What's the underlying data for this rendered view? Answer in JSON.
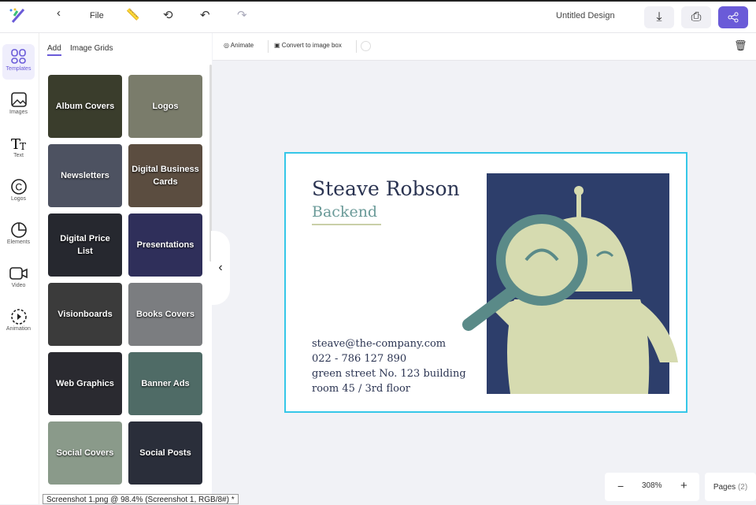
{
  "header": {
    "file": "File",
    "title": "Untitled Design"
  },
  "rail": [
    {
      "label": "Templates"
    },
    {
      "label": "Images"
    },
    {
      "label": "Text"
    },
    {
      "label": "Logos"
    },
    {
      "label": "Elements"
    },
    {
      "label": "Video"
    },
    {
      "label": "Animation"
    }
  ],
  "panel": {
    "tabs": [
      "Add",
      "Image Grids"
    ],
    "items": [
      {
        "label": "Album Covers",
        "color": "#3a3d2c"
      },
      {
        "label": "Logos",
        "color": "#7a7c6b"
      },
      {
        "label": "Newsletters",
        "color": "#4d5261"
      },
      {
        "label": "Digital Business Cards",
        "color": "#5b4d40"
      },
      {
        "label": "Digital Price List",
        "color": "#26282f"
      },
      {
        "label": "Presentations",
        "color": "#2f2f5a"
      },
      {
        "label": "Visionboards",
        "color": "#3b3b3b"
      },
      {
        "label": "Books Covers",
        "color": "#7b7d80"
      },
      {
        "label": "Web Graphics",
        "color": "#2a2a30"
      },
      {
        "label": "Banner Ads",
        "color": "#4f6b66"
      },
      {
        "label": "Social Covers",
        "color": "#8a9a8a"
      },
      {
        "label": "Social Posts",
        "color": "#2a2e3a"
      }
    ]
  },
  "toolbar": {
    "animate": "Animate",
    "convert": "Convert to image box"
  },
  "card": {
    "name": "Steave Robson",
    "role": "Backend",
    "email": "steave@the-company.com",
    "phone": "022 - 786 127 890",
    "address1": "green street No. 123 building",
    "address2": "room 45 / 3rd floor"
  },
  "zoom": {
    "value": "308%",
    "minus": "−",
    "plus": "+"
  },
  "pages": {
    "label": "Pages",
    "count": "(2)"
  },
  "status": "Screenshot 1.png @ 98.4% (Screenshot 1, RGB/8#) *"
}
